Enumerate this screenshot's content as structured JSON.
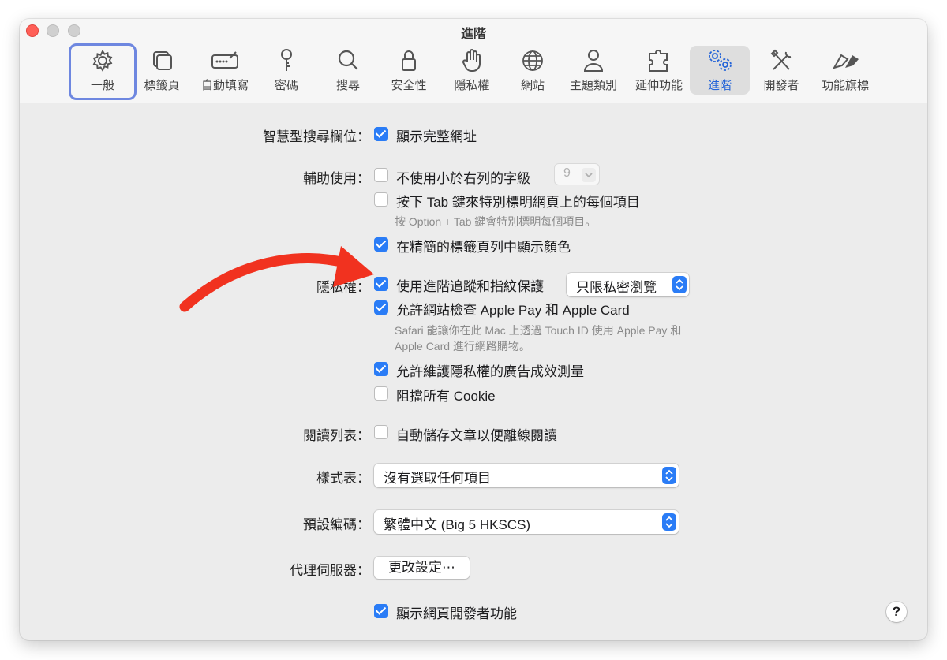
{
  "window": {
    "title": "進階"
  },
  "toolbar": [
    {
      "label": "一般",
      "icon": "gear-icon"
    },
    {
      "label": "標籤頁",
      "icon": "tabs-icon"
    },
    {
      "label": "自動填寫",
      "icon": "autofill-icon"
    },
    {
      "label": "密碼",
      "icon": "key-icon"
    },
    {
      "label": "搜尋",
      "icon": "magnifier-icon"
    },
    {
      "label": "安全性",
      "icon": "lock-icon"
    },
    {
      "label": "隱私權",
      "icon": "hand-icon"
    },
    {
      "label": "網站",
      "icon": "globe-icon"
    },
    {
      "label": "主題類別",
      "icon": "person-icon"
    },
    {
      "label": "延伸功能",
      "icon": "puzzle-icon"
    },
    {
      "label": "進階",
      "icon": "gears-icon"
    },
    {
      "label": "開發者",
      "icon": "tools-icon"
    },
    {
      "label": "功能旗標",
      "icon": "flags-icon"
    }
  ],
  "active_tab": "進階",
  "settings": {
    "smart_search": {
      "label": "智慧型搜尋欄位：",
      "show_full_address": {
        "text": "顯示完整網址",
        "checked": true
      }
    },
    "accessibility": {
      "label": "輔助使用：",
      "min_font": {
        "text": "不使用小於右列的字級",
        "checked": false,
        "value": "9"
      },
      "tab_highlight": {
        "text": "按下 Tab 鍵來特別標明網頁上的每個項目",
        "checked": false
      },
      "tab_hint": "按 Option + Tab 鍵會特別標明每個項目。",
      "compact_color": {
        "text": "在精簡的標籤頁列中顯示顏色",
        "checked": true
      }
    },
    "privacy": {
      "label": "隱私權：",
      "tracking": {
        "text": "使用進階追蹤和指紋保護",
        "checked": true,
        "popup_value": "只限私密瀏覽"
      },
      "apple_pay": {
        "text": "允許網站檢查 Apple Pay 和 Apple Card",
        "checked": true
      },
      "apple_pay_hint_1": "Safari 能讓你在此 Mac 上透過 Touch ID 使用 Apple Pay 和",
      "apple_pay_hint_2": "Apple Card 進行網路購物。",
      "ad_measure": {
        "text": "允許維護隱私權的廣告成效測量",
        "checked": true
      },
      "block_cookies": {
        "text": "阻擋所有 Cookie",
        "checked": false
      }
    },
    "reading_list": {
      "label": "閱讀列表：",
      "save_offline": {
        "text": "自動儲存文章以便離線閱讀",
        "checked": false
      }
    },
    "stylesheet": {
      "label": "樣式表：",
      "value": "沒有選取任何項目"
    },
    "encoding": {
      "label": "預設編碼：",
      "value": "繁體中文 (Big 5 HKSCS)"
    },
    "proxy": {
      "label": "代理伺服器：",
      "button": "更改設定⋯"
    },
    "developer": {
      "text": "顯示網頁開發者功能",
      "checked": true
    }
  },
  "help": "?",
  "colors": {
    "accent": "#2a7cf6",
    "annotation_arrow": "#f1321f",
    "focus_ring": "#6e87e0"
  }
}
